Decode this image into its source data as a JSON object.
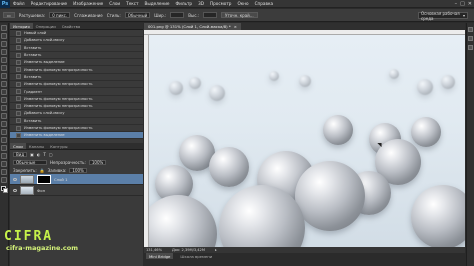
{
  "menu": {
    "logo": "Ps",
    "items": [
      "Файл",
      "Редактирование",
      "Изображение",
      "Слои",
      "Текст",
      "Выделение",
      "Фильтр",
      "3D",
      "Просмотр",
      "Окно",
      "Справка"
    ],
    "window_controls": [
      "–",
      "□",
      "✕"
    ]
  },
  "options_bar": {
    "mode_label": "Растушевка:",
    "feather_value": "0 пикс.",
    "antialias_label": "Сглаживание",
    "style_label": "Стиль:",
    "style_value": "Обычный",
    "width_label": "Шир.:",
    "height_label": "Выс.:",
    "refine_button": "Уточн. край...",
    "workspace": "Основная рабочая среда"
  },
  "history_panel": {
    "tabs": [
      "История",
      "Операции",
      "Свойства"
    ],
    "items": [
      "Новый слой",
      "Добавить слой-маску",
      "Вставить",
      "Вставить",
      "Изменить выделение",
      "Изменить фоновую непрозрачность",
      "Вставить",
      "Изменить фоновую непрозрачность",
      "Градиент",
      "Изменить фоновую непрозрачность",
      "Изменить фоновую непрозрачность",
      "Добавить слой-маску",
      "Вставить",
      "Изменить фоновую непрозрачность",
      "Изменить выделение"
    ],
    "selected_index": 14
  },
  "layers_panel": {
    "tabs": [
      "Слои",
      "Каналы",
      "Контуры"
    ],
    "kind_label": "Вид",
    "blend_mode": "Обычные",
    "opacity_label": "Непрозрачность:",
    "opacity_value": "100%",
    "lock_label": "Закрепить:",
    "fill_label": "Заливка:",
    "fill_value": "100%",
    "layers": [
      {
        "name": "Слой 1"
      },
      {
        "name": "Фон"
      }
    ]
  },
  "document": {
    "tab_title": "001.png @ 131% (Слой 1, Слой-маска/8) *",
    "zoom": "131,46%",
    "doc_info": "Док: 2,39M/3,42M",
    "bridge_tabs": [
      "Mini Bridge",
      "Шкала времени"
    ]
  },
  "watermark": {
    "logo": "CIFRA",
    "url": "cifra-magazine.com"
  },
  "colors": {
    "accent_selected": "#5b7fa8",
    "watermark_green": "#c6f24a",
    "panel_bg": "#3a3a3a"
  }
}
